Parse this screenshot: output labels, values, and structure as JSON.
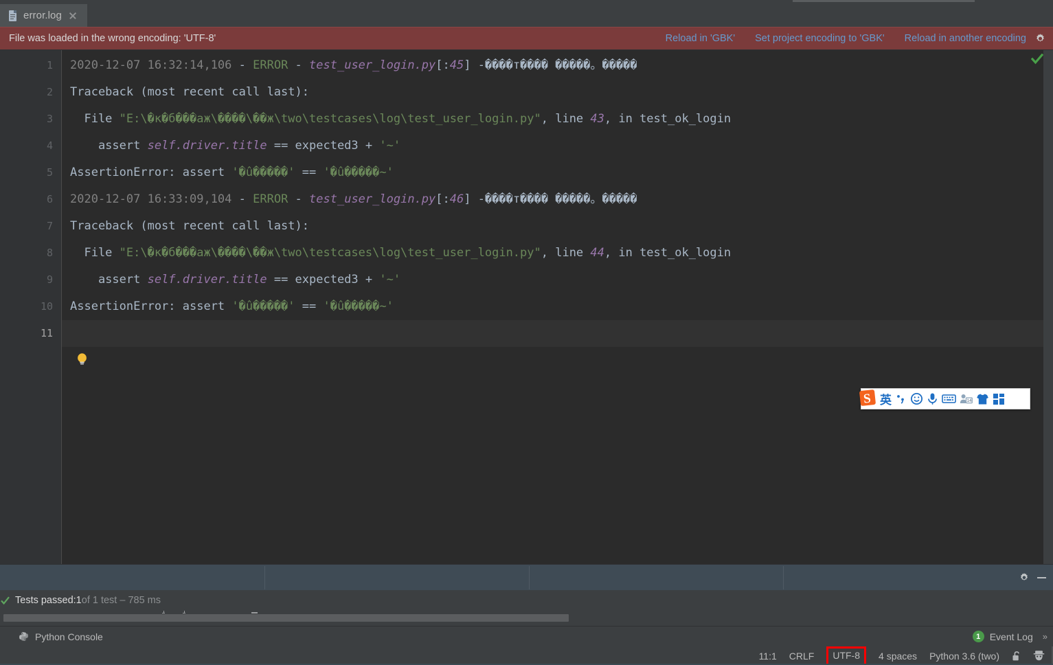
{
  "window": {
    "theme_bg": "#3c3f41",
    "editor_bg": "#2b2b2b",
    "banner_bg": "#7b3b3b",
    "accent_link": "#6699cc",
    "highlight_box": "#ff0000"
  },
  "tab": {
    "label": "error.log",
    "file_icon": "file-icon",
    "close_icon": "close-icon"
  },
  "banner": {
    "message": "File was loaded in the wrong encoding: 'UTF-8'",
    "actions": [
      {
        "label": "Reload in 'GBK'"
      },
      {
        "label": "Set project encoding to 'GBK'"
      },
      {
        "label": "Reload in another encoding"
      }
    ],
    "settings_icon": "gear-icon"
  },
  "editor": {
    "inspection_status": "ok-check-icon",
    "intention_icon": "lightbulb-icon",
    "current_line": 11,
    "line_numbers": [
      "1",
      "2",
      "3",
      "4",
      "5",
      "6",
      "7",
      "8",
      "9",
      "10",
      "11"
    ],
    "lines": [
      {
        "n": 1,
        "tokens": [
          {
            "t": "2020-12-07 16:32:14,106 ",
            "c": "tk-date"
          },
          {
            "t": "- ",
            "c": "tk-plain"
          },
          {
            "t": "ERROR",
            "c": "tk-err"
          },
          {
            "t": " - ",
            "c": "tk-plain"
          },
          {
            "t": "test_user_login.py",
            "c": "tk-pyfile"
          },
          {
            "t": "[:",
            "c": "tk-plain"
          },
          {
            "t": "45",
            "c": "tk-num"
          },
          {
            "t": "] -",
            "c": "tk-plain"
          },
          {
            "t": "����т���� �����。�����",
            "c": "tk-moji-blue"
          }
        ]
      },
      {
        "n": 2,
        "tokens": [
          {
            "t": "Traceback (most recent call last):",
            "c": "tk-plain"
          }
        ]
      },
      {
        "n": 3,
        "tokens": [
          {
            "t": "  File ",
            "c": "tk-plain"
          },
          {
            "t": "\"E:\\�к�б���аж\\����\\��ж\\two\\testcases\\log\\test_user_login.py\"",
            "c": "tk-str"
          },
          {
            "t": ", line ",
            "c": "tk-plain"
          },
          {
            "t": "43",
            "c": "tk-num"
          },
          {
            "t": ", in test_ok_login",
            "c": "tk-plain"
          }
        ]
      },
      {
        "n": 4,
        "tokens": [
          {
            "t": "    assert ",
            "c": "tk-plain"
          },
          {
            "t": "self.driver.title",
            "c": "tk-attr"
          },
          {
            "t": " == expected3 + ",
            "c": "tk-plain"
          },
          {
            "t": "'~'",
            "c": "tk-str"
          }
        ]
      },
      {
        "n": 5,
        "tokens": [
          {
            "t": "AssertionError: assert ",
            "c": "tk-plain"
          },
          {
            "t": "'�û�����'",
            "c": "tk-moji"
          },
          {
            "t": " == ",
            "c": "tk-plain"
          },
          {
            "t": "'�û�����~'",
            "c": "tk-moji"
          }
        ]
      },
      {
        "n": 6,
        "tokens": [
          {
            "t": "2020-12-07 16:33:09,104 ",
            "c": "tk-date"
          },
          {
            "t": "- ",
            "c": "tk-plain"
          },
          {
            "t": "ERROR",
            "c": "tk-err"
          },
          {
            "t": " - ",
            "c": "tk-plain"
          },
          {
            "t": "test_user_login.py",
            "c": "tk-pyfile"
          },
          {
            "t": "[:",
            "c": "tk-plain"
          },
          {
            "t": "46",
            "c": "tk-num"
          },
          {
            "t": "] -",
            "c": "tk-plain"
          },
          {
            "t": "����т���� �����。�����",
            "c": "tk-moji-blue"
          }
        ]
      },
      {
        "n": 7,
        "tokens": [
          {
            "t": "Traceback (most recent call last):",
            "c": "tk-plain"
          }
        ]
      },
      {
        "n": 8,
        "tokens": [
          {
            "t": "  File ",
            "c": "tk-plain"
          },
          {
            "t": "\"E:\\�к�б���аж\\����\\��ж\\two\\testcases\\log\\test_user_login.py\"",
            "c": "tk-str"
          },
          {
            "t": ", line ",
            "c": "tk-plain"
          },
          {
            "t": "44",
            "c": "tk-num"
          },
          {
            "t": ", in test_ok_login",
            "c": "tk-plain"
          }
        ]
      },
      {
        "n": 9,
        "tokens": [
          {
            "t": "    assert ",
            "c": "tk-plain"
          },
          {
            "t": "self.driver.title",
            "c": "tk-attr"
          },
          {
            "t": " == expected3 + ",
            "c": "tk-plain"
          },
          {
            "t": "'~'",
            "c": "tk-str"
          }
        ]
      },
      {
        "n": 10,
        "tokens": [
          {
            "t": "AssertionError: assert ",
            "c": "tk-plain"
          },
          {
            "t": "'�û�����'",
            "c": "tk-moji"
          },
          {
            "t": " == ",
            "c": "tk-plain"
          },
          {
            "t": "'�û�����~'",
            "c": "tk-moji"
          }
        ]
      },
      {
        "n": 11,
        "tokens": [
          {
            "t": "",
            "c": "tk-plain"
          }
        ]
      }
    ]
  },
  "ime": {
    "logo": "sogou-logo-icon",
    "mode_label": "英",
    "items": [
      {
        "name": "punctuation-icon"
      },
      {
        "name": "emoji-icon"
      },
      {
        "name": "microphone-icon"
      },
      {
        "name": "soft-keyboard-icon"
      },
      {
        "name": "user-center-icon"
      },
      {
        "name": "skin-icon"
      },
      {
        "name": "apps-menu-icon"
      }
    ]
  },
  "run_panel": {
    "settings_icon": "gear-icon",
    "minimize_icon": "minimize-icon"
  },
  "test_results": {
    "status_icon": "green-check-icon",
    "passed_prefix": "Tests passed: ",
    "passed_count": "1",
    "suffix": " of 1 test – 785 ms"
  },
  "tool_window_bar": {
    "python_console": {
      "label": "Python Console",
      "icon": "python-icon"
    },
    "event_log": {
      "label": "Event Log",
      "count": "1"
    },
    "expander": "»"
  },
  "status_bar": {
    "caret_position": "11:1",
    "line_separator": "CRLF",
    "encoding": "UTF-8",
    "indent": "4 spaces",
    "interpreter": "Python 3.6 (two)",
    "lock_icon": "unlocked-icon",
    "inspector_icon": "detective-icon"
  }
}
